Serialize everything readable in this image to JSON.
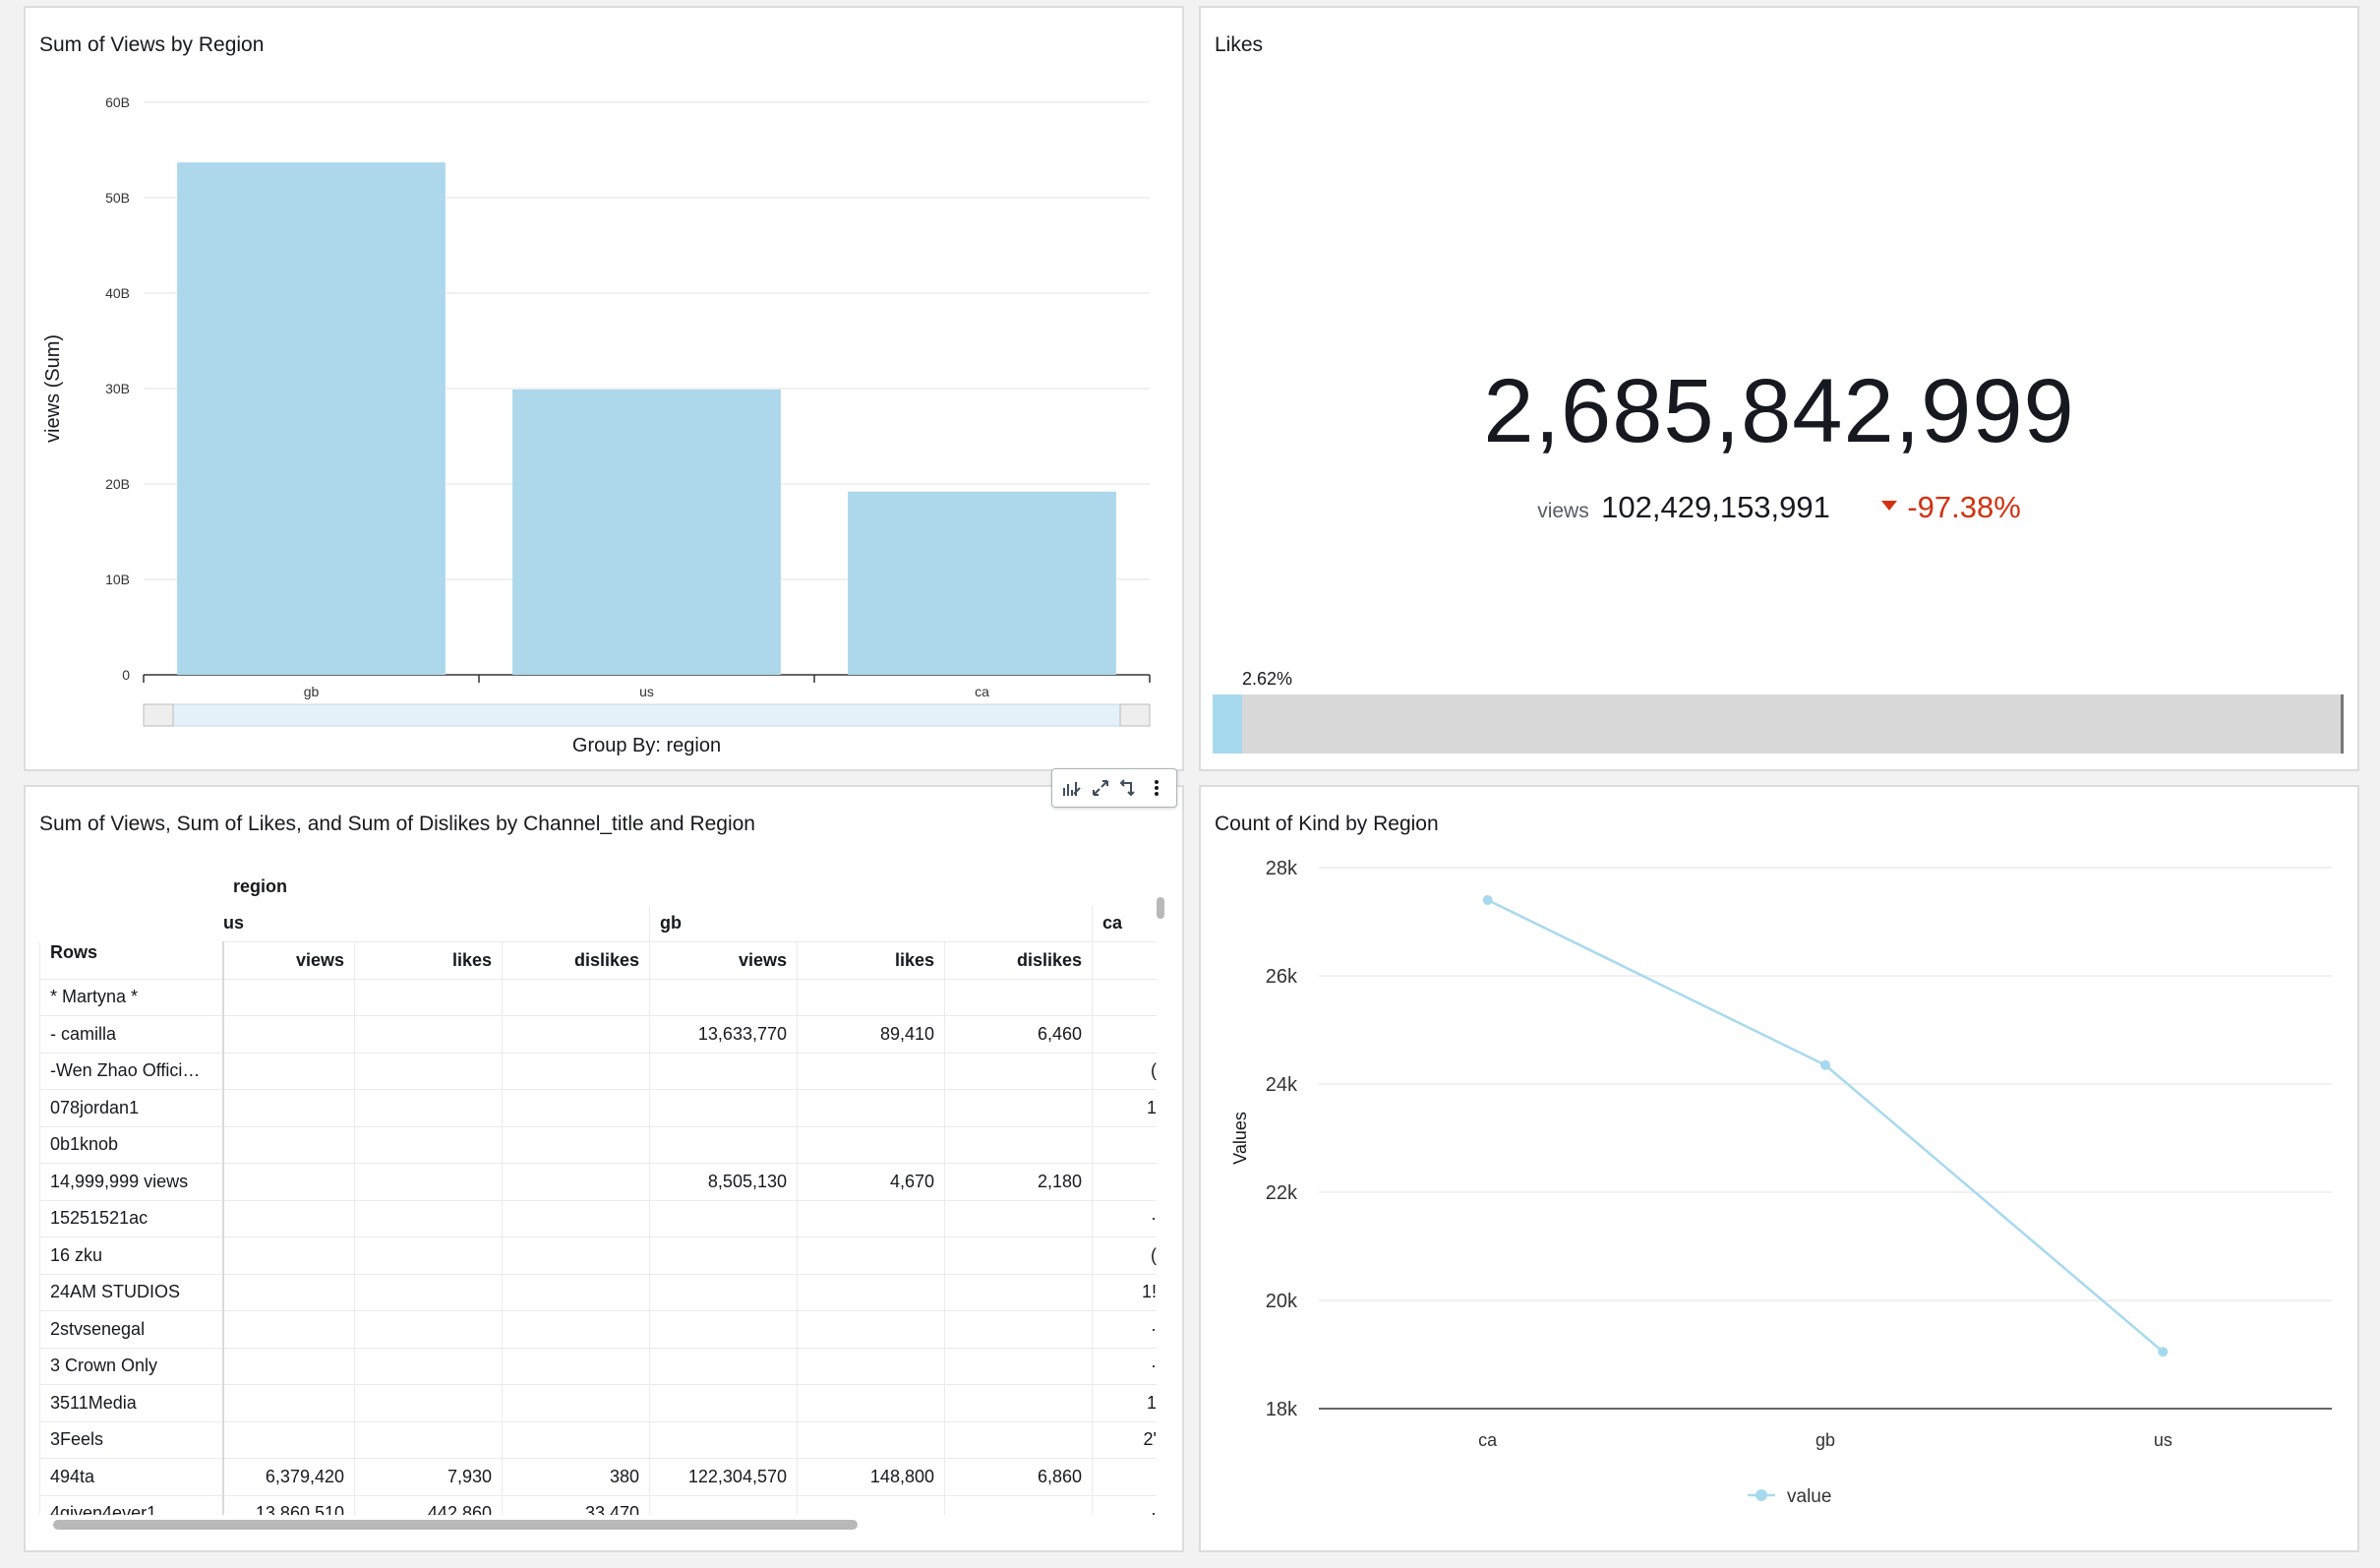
{
  "bar_panel": {
    "title": "Sum of Views by Region",
    "group_by_label": "Group By: region",
    "chart_data": {
      "type": "bar",
      "title": "Sum of Views by Region",
      "xlabel": "",
      "ylabel": "views (Sum)",
      "categories": [
        "gb",
        "us",
        "ca"
      ],
      "values": [
        53700000000,
        29900000000,
        19200000000
      ],
      "ylim": [
        0,
        60000000000
      ],
      "yticks": [
        "0",
        "10B",
        "20B",
        "30B",
        "40B",
        "50B",
        "60B"
      ],
      "grid": true,
      "color": "#add8ec"
    }
  },
  "kpi_panel": {
    "title": "Likes",
    "value": "2,685,842,999",
    "compare_label": "views",
    "compare_value": "102,429,153,991",
    "delta": "-97.38%",
    "delta_color": "#d13212",
    "progress_label": "2.62%",
    "progress_fraction": 0.0262,
    "progress_color": "#a7d9ee"
  },
  "table_panel": {
    "title": "Sum of Views, Sum of Likes, and Sum of Dislikes by Channel_title and Region",
    "column_field": "region",
    "rows_label": "Rows",
    "region_groups": [
      "us",
      "gb",
      "ca"
    ],
    "measures": [
      "views",
      "likes",
      "dislikes"
    ],
    "rows": [
      {
        "name": "* Martyna *",
        "us": [
          "",
          "",
          ""
        ],
        "gb": [
          "",
          "",
          ""
        ],
        "ca": ""
      },
      {
        "name": "- camilla",
        "us": [
          "",
          "",
          ""
        ],
        "gb": [
          "13,633,770",
          "89,410",
          "6,460"
        ],
        "ca": ""
      },
      {
        "name": "-Wen Zhao Offici…",
        "us": [
          "",
          "",
          ""
        ],
        "gb": [
          "",
          "",
          ""
        ],
        "ca": "("
      },
      {
        "name": "078jordan1",
        "us": [
          "",
          "",
          ""
        ],
        "gb": [
          "",
          "",
          ""
        ],
        "ca": "1"
      },
      {
        "name": "0b1knob",
        "us": [
          "",
          "",
          ""
        ],
        "gb": [
          "",
          "",
          ""
        ],
        "ca": ""
      },
      {
        "name": "14,999,999 views",
        "us": [
          "",
          "",
          ""
        ],
        "gb": [
          "8,505,130",
          "4,670",
          "2,180"
        ],
        "ca": ""
      },
      {
        "name": "15251521ac",
        "us": [
          "",
          "",
          ""
        ],
        "gb": [
          "",
          "",
          ""
        ],
        "ca": "·"
      },
      {
        "name": "16 zku",
        "us": [
          "",
          "",
          ""
        ],
        "gb": [
          "",
          "",
          ""
        ],
        "ca": "("
      },
      {
        "name": "24AM STUDIOS",
        "us": [
          "",
          "",
          ""
        ],
        "gb": [
          "",
          "",
          ""
        ],
        "ca": "1!"
      },
      {
        "name": "2stvsenegal",
        "us": [
          "",
          "",
          ""
        ],
        "gb": [
          "",
          "",
          ""
        ],
        "ca": "·"
      },
      {
        "name": "3 Crown Only",
        "us": [
          "",
          "",
          ""
        ],
        "gb": [
          "",
          "",
          ""
        ],
        "ca": "·"
      },
      {
        "name": "3511Media",
        "us": [
          "",
          "",
          ""
        ],
        "gb": [
          "",
          "",
          ""
        ],
        "ca": "1"
      },
      {
        "name": "3Feels",
        "us": [
          "",
          "",
          ""
        ],
        "gb": [
          "",
          "",
          ""
        ],
        "ca": "2'"
      },
      {
        "name": "494ta",
        "us": [
          "6,379,420",
          "7,930",
          "380"
        ],
        "gb": [
          "122,304,570",
          "148,800",
          "6,860"
        ],
        "ca": ""
      },
      {
        "name": "4given4ever1",
        "us": [
          "13,860,510",
          "442,860",
          "33,470"
        ],
        "gb": [
          "",
          "",
          ""
        ],
        "ca": "·"
      }
    ]
  },
  "line_panel": {
    "title": "Count of Kind by Region",
    "legend_label": "value",
    "chart_data": {
      "type": "line",
      "title": "Count of Kind by Region",
      "xlabel": "",
      "ylabel": "Values",
      "x": [
        "ca",
        "gb",
        "us"
      ],
      "series": [
        {
          "name": "value",
          "values": [
            27400,
            24350,
            19050
          ]
        }
      ],
      "ylim": [
        18000,
        28000
      ],
      "yticks": [
        "18k",
        "20k",
        "22k",
        "24k",
        "26k",
        "28k"
      ],
      "grid": true,
      "legend": "bottom",
      "color": "#a7d9ee"
    }
  },
  "toolbar": {
    "icons": [
      "chart-analyze-icon",
      "expand-icon",
      "swap-axes-icon",
      "more-options-icon"
    ]
  }
}
